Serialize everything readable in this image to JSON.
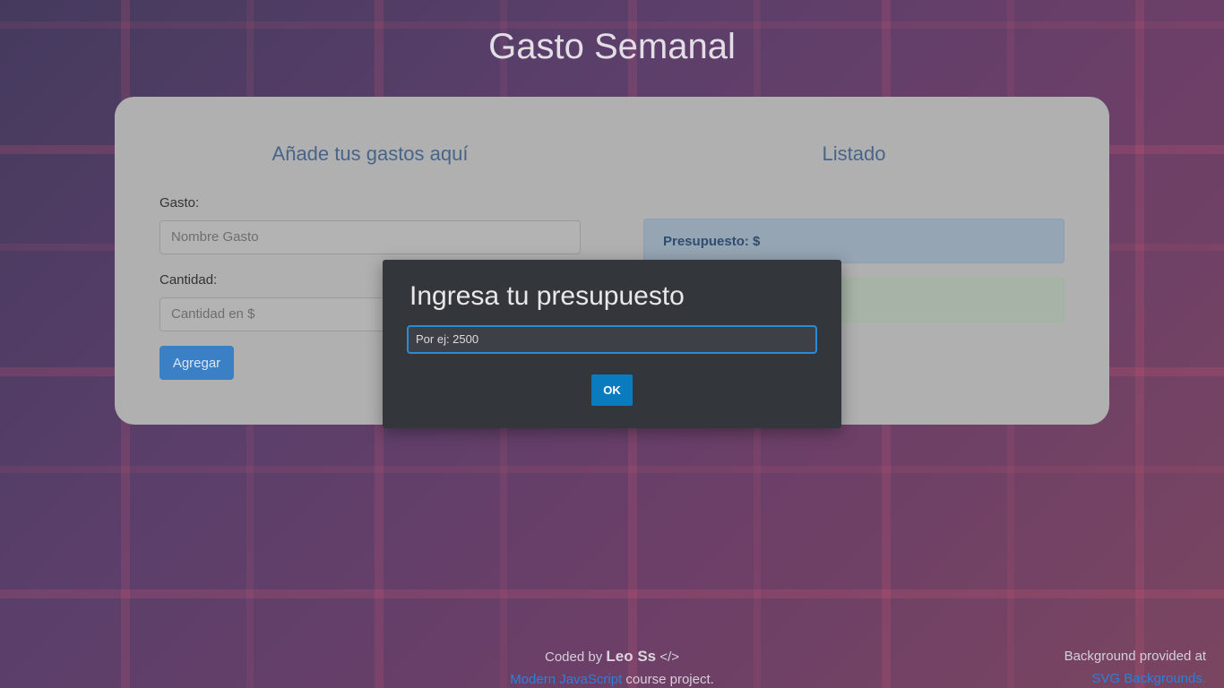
{
  "page": {
    "title": "Gasto Semanal"
  },
  "form": {
    "heading": "Añade tus gastos aquí",
    "gasto_label": "Gasto:",
    "gasto_placeholder": "Nombre Gasto",
    "cantidad_label": "Cantidad:",
    "cantidad_placeholder": "Cantidad en $",
    "submit_label": "Agregar"
  },
  "listado": {
    "heading": "Listado",
    "presupuesto_label": "Presupuesto: $"
  },
  "modal": {
    "title": "Ingresa tu presupuesto",
    "input_placeholder": "Por ej: 2500",
    "ok_label": "OK"
  },
  "footer": {
    "coded_by": "Coded by",
    "author": "Leo Ss",
    "code_symbol": "</>",
    "course_link": "Modern JavaScript",
    "course_suffix": "course project.",
    "bg_text": "Background provided at",
    "bg_link": "SVG Backgrounds."
  }
}
